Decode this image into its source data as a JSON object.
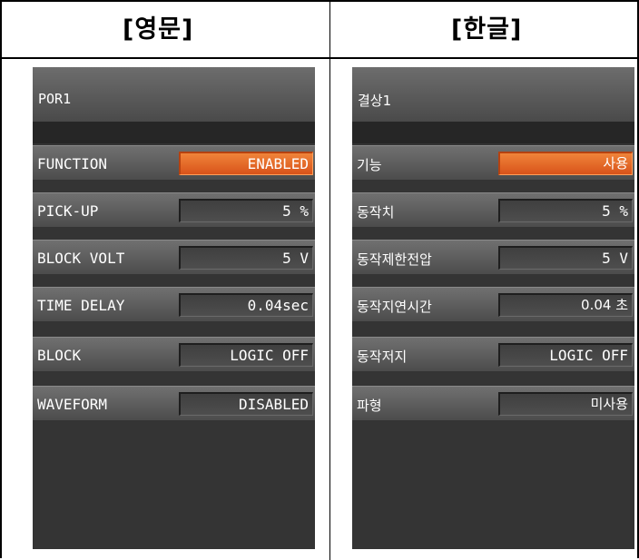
{
  "headers": {
    "english": "[영문]",
    "korean": "[한글]"
  },
  "colors": {
    "enabled_accent": "#e8692a",
    "panel_bg": "#343434"
  },
  "english_panel": {
    "title": "POR1",
    "rows": [
      {
        "label": "FUNCTION",
        "value": "ENABLED",
        "highlighted": true
      },
      {
        "label": "PICK-UP",
        "value": "5 %"
      },
      {
        "label": "BLOCK VOLT",
        "value": "5 V"
      },
      {
        "label": "TIME DELAY",
        "value": "0.04sec"
      },
      {
        "label": "BLOCK",
        "value": "LOGIC OFF"
      },
      {
        "label": "WAVEFORM",
        "value": "DISABLED"
      }
    ]
  },
  "korean_panel": {
    "title": "결상1",
    "rows": [
      {
        "label": "기능",
        "value": "사용",
        "highlighted": true
      },
      {
        "label": "동작치",
        "value": "5 %"
      },
      {
        "label": "동작제한전압",
        "value": "5 V"
      },
      {
        "label": "동작지연시간",
        "value": "0.04 초"
      },
      {
        "label": "동작저지",
        "value": "LOGIC OFF"
      },
      {
        "label": "파형",
        "value": "미사용"
      }
    ]
  }
}
